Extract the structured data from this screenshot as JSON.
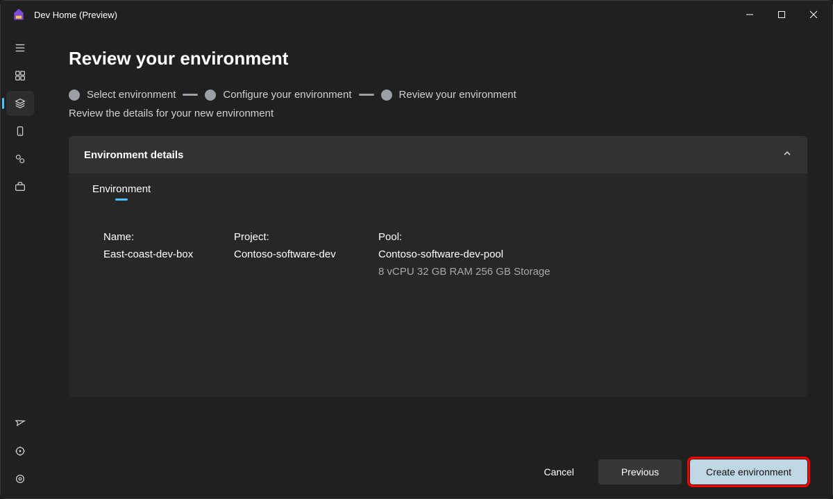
{
  "titlebar": {
    "app_title": "Dev Home (Preview)"
  },
  "page": {
    "title": "Review your environment",
    "subtitle": "Review the details for your new environment"
  },
  "stepper": {
    "steps": [
      {
        "label": "Select environment"
      },
      {
        "label": "Configure your environment"
      },
      {
        "label": "Review your environment"
      }
    ]
  },
  "card": {
    "header": "Environment details",
    "tab": "Environment",
    "fields": {
      "name_label": "Name:",
      "name_value": "East-coast-dev-box",
      "project_label": "Project:",
      "project_value": "Contoso-software-dev",
      "pool_label": "Pool:",
      "pool_value": "Contoso-software-dev-pool",
      "pool_spec": "8 vCPU 32 GB RAM 256 GB Storage"
    }
  },
  "footer": {
    "cancel": "Cancel",
    "previous": "Previous",
    "create": "Create environment"
  }
}
